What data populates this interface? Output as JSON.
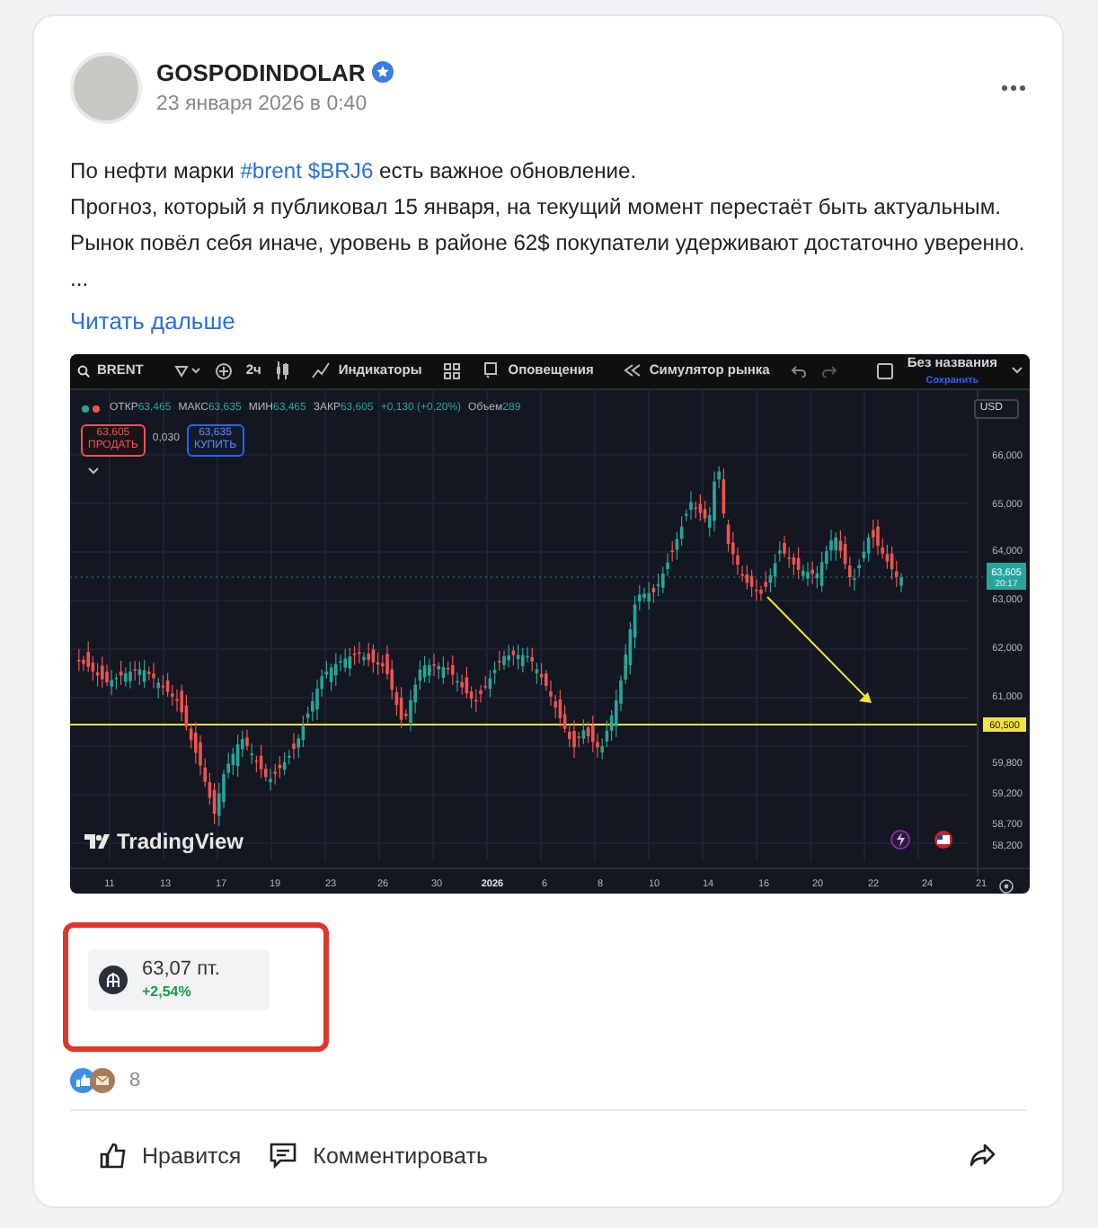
{
  "post": {
    "author": {
      "name": "GOSPODINDOLAR",
      "verified": true
    },
    "date": "23 января 2026 в 0:40",
    "paragraphs": [
      [
        {
          "kind": "text",
          "text": "По нефти марки "
        },
        {
          "kind": "link",
          "text": "#brent"
        },
        {
          "kind": "link",
          "text": "$BRJ6",
          "space_before": true
        },
        {
          "kind": "text",
          "text": " есть важное обновление."
        }
      ],
      [
        {
          "kind": "text",
          "text": "Прогноз, который я публиковал 15 января, на текущий момент перестаёт быть актуальным."
        }
      ],
      [
        {
          "kind": "text",
          "text": "Рынок повёл себя иначе, уровень в районе 62$ покупатели удерживают достаточно уверенно."
        }
      ],
      [
        {
          "kind": "text",
          "text": "..."
        }
      ]
    ],
    "read_more": "Читать дальше",
    "chart_screenshot": {
      "symbol": "BRENT",
      "interval": "2ч",
      "toolbar": [
        "Индикаторы",
        "Оповещения",
        "Симулятор рынка"
      ],
      "layout_name": "Без названия",
      "save": "Сохранить",
      "currency": "USD",
      "legend": [
        {
          "label": "ОТКР",
          "value": "63,465"
        },
        {
          "label": "МАКС",
          "value": "63,635"
        },
        {
          "label": "МИН",
          "value": "63,465"
        },
        {
          "label": "ЗАКР",
          "value": "63,605"
        }
      ],
      "change": "+0,130 (+0,20%)",
      "volume_label": "Объем",
      "volume": "289",
      "sell": {
        "price": "63,605",
        "label": "ПРОДАТЬ"
      },
      "spread": "0,030",
      "buy": {
        "price": "63,635",
        "label": "КУПИТЬ"
      },
      "price_labels": [
        {
          "kind": "tick",
          "text": "66,000"
        },
        {
          "kind": "tick",
          "text": "65,000"
        },
        {
          "kind": "tick",
          "text": "64,000"
        },
        {
          "kind": "last",
          "text": "63,605",
          "time": "20:17"
        },
        {
          "kind": "tick",
          "text": "63,000"
        },
        {
          "kind": "tick",
          "text": "62,000"
        },
        {
          "kind": "tick",
          "text": "61,000"
        },
        {
          "kind": "line",
          "text": "60,500"
        },
        {
          "kind": "tick",
          "text": "59,800"
        },
        {
          "kind": "tick",
          "text": "59,200"
        },
        {
          "kind": "tick",
          "text": "58,700"
        },
        {
          "kind": "tick",
          "text": "58,200"
        }
      ],
      "date_labels": [
        {
          "text": "11",
          "bold": false
        },
        {
          "text": "13",
          "bold": false
        },
        {
          "text": "17",
          "bold": false
        },
        {
          "text": "19",
          "bold": false
        },
        {
          "text": "23",
          "bold": false
        },
        {
          "text": "26",
          "bold": false
        },
        {
          "text": "30",
          "bold": false
        },
        {
          "text": "2026",
          "bold": true
        },
        {
          "text": "6",
          "bold": false
        },
        {
          "text": "8",
          "bold": false
        },
        {
          "text": "10",
          "bold": false
        },
        {
          "text": "14",
          "bold": false
        },
        {
          "text": "16",
          "bold": false
        },
        {
          "text": "20",
          "bold": false
        },
        {
          "text": "22",
          "bold": false
        },
        {
          "text": "24",
          "bold": false
        },
        {
          "text": "21",
          "bold": false
        }
      ],
      "logo": "TradingView"
    },
    "instrument": {
      "price": "63,07 пт.",
      "change": "+2,54%",
      "highlighted": true
    },
    "reactions": {
      "count": "8"
    },
    "actions": [
      {
        "kind": "like",
        "label": "Нравится"
      },
      {
        "kind": "comment",
        "label": "Комментировать"
      },
      {
        "kind": "share"
      }
    ]
  }
}
